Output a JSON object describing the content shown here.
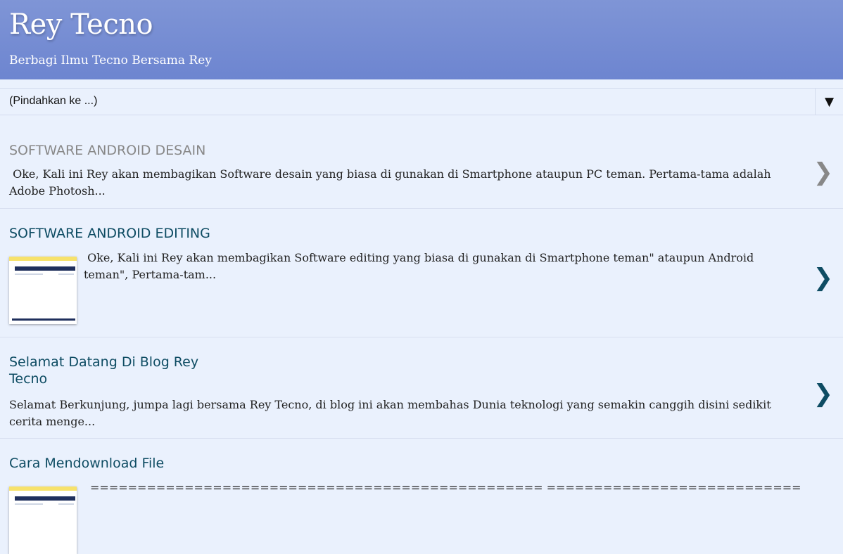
{
  "header": {
    "title": "Rey Tecno",
    "description": "Berbagi Ilmu Tecno Bersama Rey"
  },
  "nav_select": {
    "label": "(Pindahkan ke ...)",
    "arrow": "▼"
  },
  "posts": [
    {
      "title": "SOFTWARE ANDROID DESAIN",
      "snippet": " Oke, Kali ini Rey akan membagikan Software desain yang biasa di gunakan di Smartphone ataupun PC teman. Pertama-tama adalah Adobe Photosh...",
      "visited": true,
      "has_thumbnail": false
    },
    {
      "title": "SOFTWARE ANDROID EDITING",
      "snippet": " Oke, Kali ini Rey akan membagikan Software editing yang biasa di gunakan di Smartphone teman\" ataupun Android teman\", Pertama-tam...",
      "visited": false,
      "has_thumbnail": true
    },
    {
      "title_line1": "Selamat Datang Di Blog Rey",
      "title_line2": "Tecno",
      "snippet": "Selamat Berkunjung, jumpa lagi bersama Rey Tecno, di blog ini akan membahas Dunia teknologi yang semakin canggih disini sedikit cerita menge...",
      "visited": false,
      "has_thumbnail": false
    },
    {
      "title": "Cara Mendownload File",
      "snippet": "================================================ ============================ Sebelum",
      "visited": false,
      "has_thumbnail": true
    }
  ],
  "icons": {
    "chevron": "❯",
    "chevron_name": "chevron-right-icon"
  },
  "colors": {
    "header_bg": "#7589d3",
    "page_bg": "#eaf1fd",
    "link": "#0e4c63",
    "visited_link": "#888888"
  }
}
